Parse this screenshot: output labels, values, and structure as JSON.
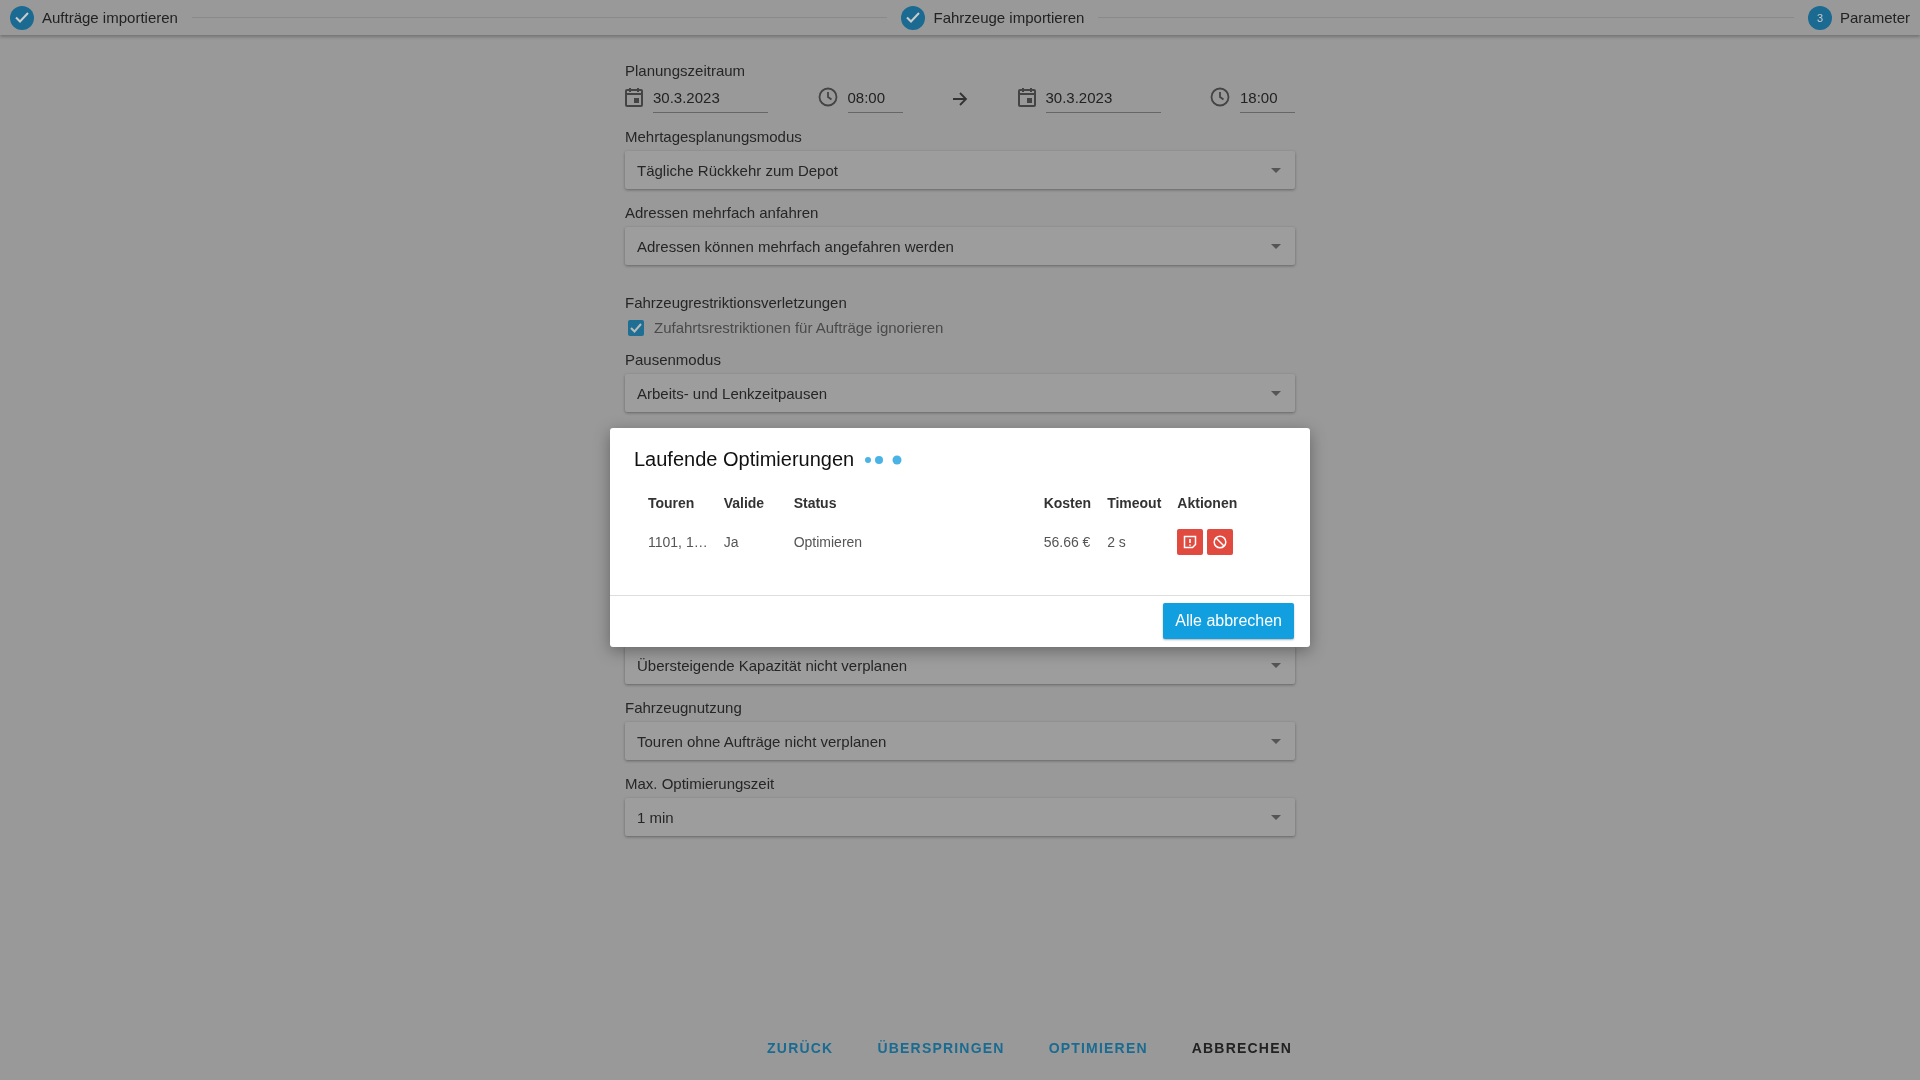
{
  "stepper": [
    {
      "label": "Aufträge importieren",
      "completed": true
    },
    {
      "label": "Fahrzeuge importieren",
      "completed": true
    },
    {
      "label": "Parameter",
      "completed": false,
      "number": "3"
    }
  ],
  "form_top": [
    {
      "kind": "period",
      "label": "Planungszeitraum",
      "start_date": "30.3.2023",
      "start_time": "08:00",
      "end_date": "30.3.2023",
      "end_time": "18:00"
    },
    {
      "kind": "select",
      "label": "Mehrtagesplanungsmodus",
      "value": "Tägliche Rückkehr zum Depot"
    },
    {
      "kind": "select",
      "label": "Adressen mehrfach anfahren",
      "value": "Adressen können mehrfach angefahren werden"
    },
    {
      "kind": "checkbox",
      "label": "Fahrzeugrestriktionsverletzungen",
      "option": "Zufahrtsrestriktionen für Aufträge ignorieren",
      "checked": true
    },
    {
      "kind": "select",
      "label": "Pausenmodus",
      "value": "Arbeits- und Lenkzeitpausen"
    }
  ],
  "form_bottom": [
    {
      "kind": "select",
      "value": "Übersteigende Kapazität nicht verplanen"
    },
    {
      "kind": "select",
      "label": "Fahrzeugnutzung",
      "value": "Touren ohne Aufträge nicht verplanen"
    },
    {
      "kind": "select",
      "label": "Max. Optimierungszeit",
      "value": "1 min"
    }
  ],
  "footer_buttons": [
    {
      "label": "ZURÜCK",
      "kind": "accent"
    },
    {
      "label": "ÜBERSPRINGEN",
      "kind": "accent"
    },
    {
      "label": "OPTIMIEREN",
      "kind": "accent"
    },
    {
      "label": "ABBRECHEN",
      "kind": "plain"
    }
  ],
  "dialog": {
    "title": "Laufende Optimierungen",
    "columns": [
      "Touren",
      "Valide",
      "Status",
      "Kosten",
      "Timeout",
      "Aktionen"
    ],
    "rows": [
      {
        "cells": [
          "1101, 1…",
          "Ja",
          "Optimieren",
          "56.66 €",
          "2 s"
        ]
      }
    ],
    "button": "Alle abbrechen"
  }
}
